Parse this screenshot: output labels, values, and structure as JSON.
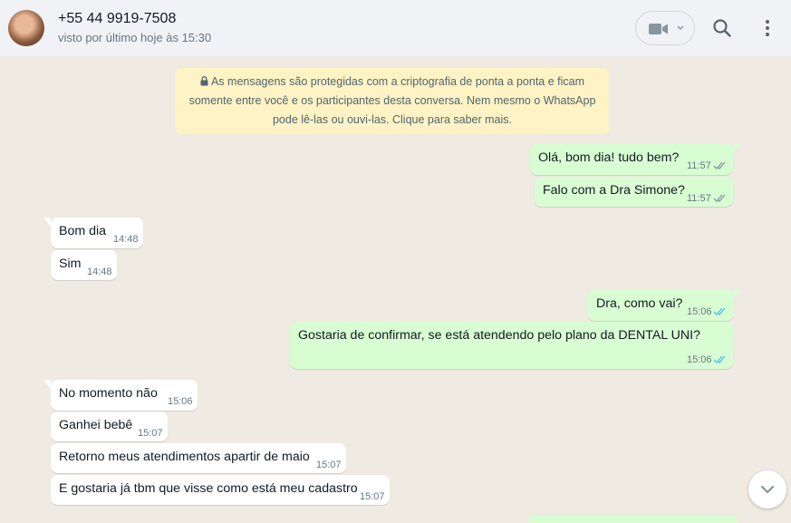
{
  "header": {
    "name": "+55 44 9919-7508",
    "status": "visto por último hoje às 15:30"
  },
  "encryption_notice": {
    "line1": "As mensagens são protegidas com a criptografia de ponta a ponta e ficam",
    "line2": "somente entre você e os participantes desta conversa. Nem mesmo o WhatsApp",
    "line3": "pode lê-las ou ouvi-las. Clique para saber mais."
  },
  "messages": [
    {
      "text": "Olá, bom dia! tudo bem?",
      "time": "11:57",
      "dir": "out",
      "read": false
    },
    {
      "text": "Falo com a Dra Simone?",
      "time": "11:57",
      "dir": "out",
      "read": false
    },
    {
      "text": "Bom dia",
      "time": "14:48",
      "dir": "in"
    },
    {
      "text": "Sim",
      "time": "14:48",
      "dir": "in"
    },
    {
      "text": "Dra, como vai?",
      "time": "15:06",
      "dir": "out",
      "read": true
    },
    {
      "text": "Gostaria de confirmar, se está atendendo pelo plano da DENTAL UNI?",
      "time": "15:06",
      "dir": "out",
      "read": true
    },
    {
      "text": "No momento não",
      "time": "15:06",
      "dir": "in"
    },
    {
      "text": "Ganhei bebê",
      "time": "15:07",
      "dir": "in"
    },
    {
      "text": "Retorno meus atendimentos apartir de maio",
      "time": "15:07",
      "dir": "in"
    },
    {
      "text": "E gostaria já tbm que visse como está meu cadastro",
      "time": "15:07",
      "dir": "in"
    }
  ],
  "colors": {
    "outgoing_bubble": "#d9fdd3",
    "incoming_bubble": "#ffffff",
    "read_tick": "#53bdeb",
    "sent_tick": "#8696a0",
    "notice_bg": "#fdf3c5",
    "chat_bg": "#efeae2"
  },
  "icons": {
    "video": "video-call-icon",
    "search": "search-icon",
    "menu": "menu-icon",
    "scroll_down": "chevron-down-icon",
    "lock": "lock-icon"
  }
}
